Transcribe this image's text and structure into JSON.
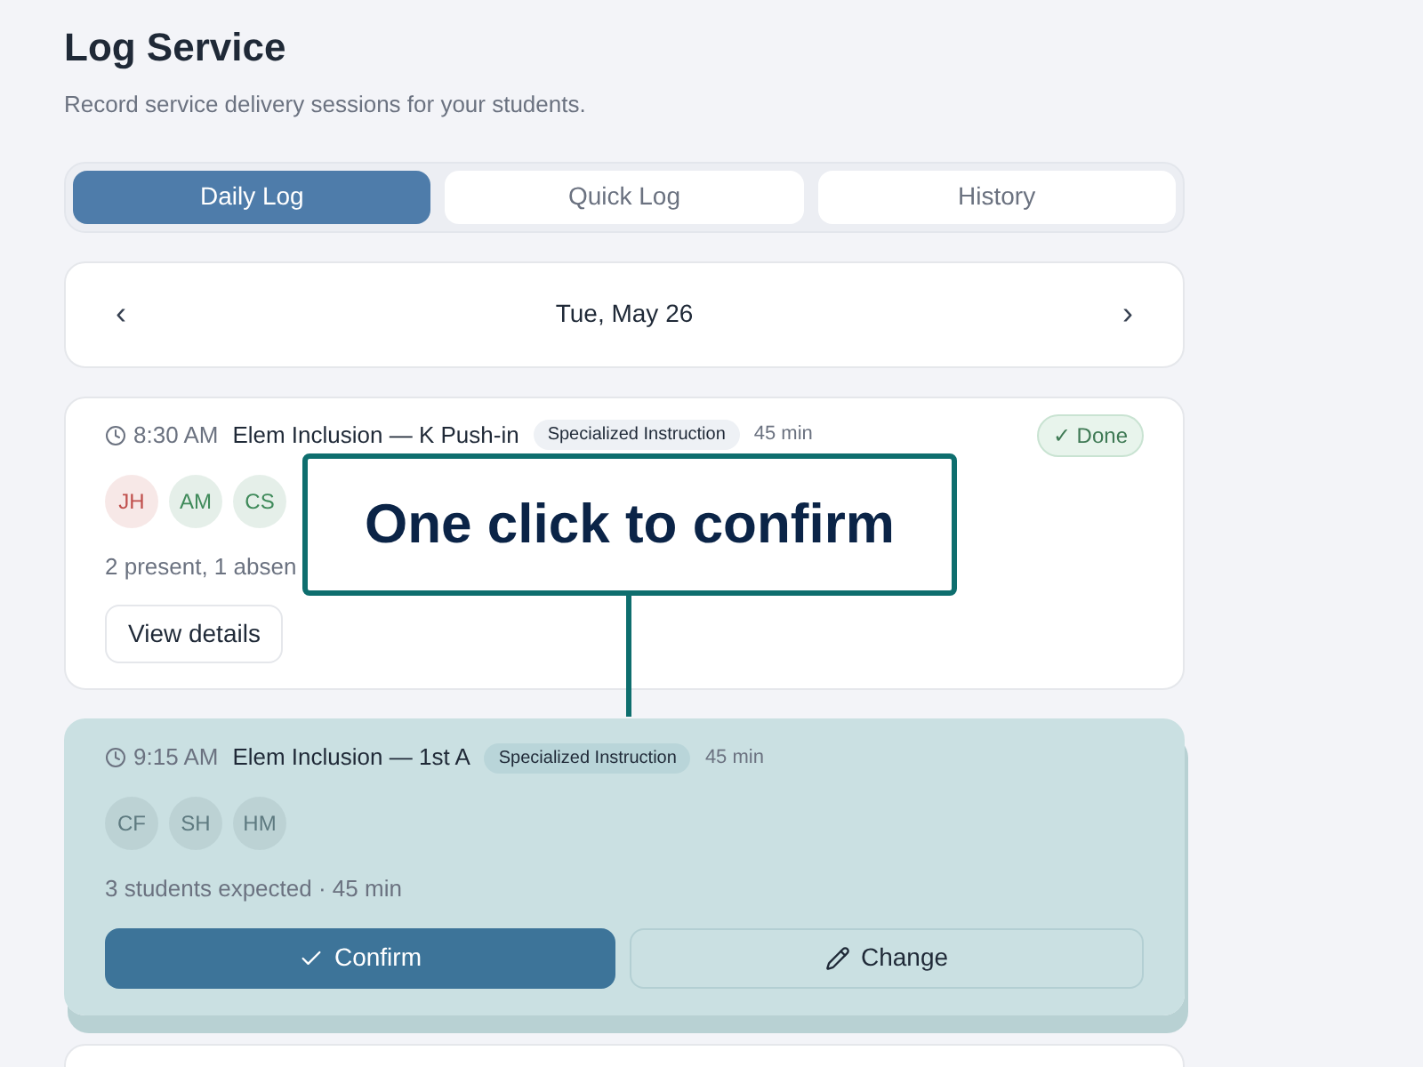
{
  "header": {
    "title": "Log Service",
    "subtitle": "Record service delivery sessions for your students."
  },
  "tabs": [
    {
      "label": "Daily Log",
      "selected": true
    },
    {
      "label": "Quick Log",
      "selected": false
    },
    {
      "label": "History",
      "selected": false
    }
  ],
  "date_nav": {
    "prev": "‹",
    "date": "Tue, May 26",
    "next": "›"
  },
  "sessions": [
    {
      "time": "8:30 AM",
      "name": "Elem Inclusion — K Push-in",
      "tag": "Specialized Instruction",
      "duration": "45 min",
      "highlighted": false,
      "status": "✓ Done",
      "students": [
        {
          "initials": "JH",
          "color": "#c0504d"
        },
        {
          "initials": "AM",
          "color": "#3f8a5a"
        },
        {
          "initials": "CS",
          "color": "#3f8a5a"
        }
      ],
      "summary": "2 present, 1 absen",
      "actions": [
        {
          "kind": "secondary",
          "label": "View details"
        }
      ]
    },
    {
      "time": "9:15 AM",
      "name": "Elem Inclusion — 1st A",
      "tag": "Specialized Instruction",
      "duration": "45 min",
      "highlighted": true,
      "students": [
        {
          "initials": "CF",
          "color": "#5e7a80"
        },
        {
          "initials": "SH",
          "color": "#5e7a80"
        },
        {
          "initials": "HM",
          "color": "#5e7a80"
        }
      ],
      "summary": "3 students expected · 45 min",
      "actions": [
        {
          "kind": "confirm",
          "label": "Confirm"
        },
        {
          "kind": "change",
          "label": "Change"
        }
      ]
    }
  ],
  "callout": {
    "text": "One click to confirm"
  }
}
